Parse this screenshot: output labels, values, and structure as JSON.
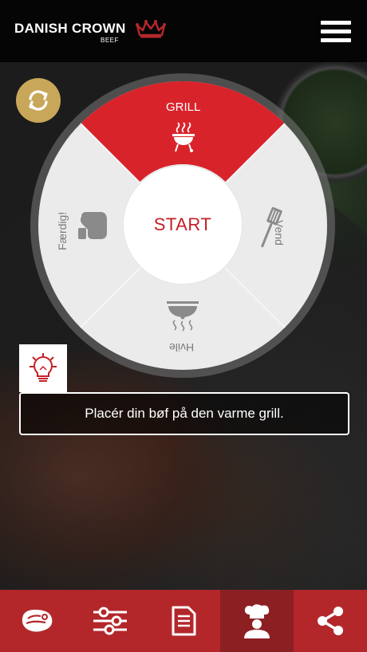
{
  "header": {
    "brand_name": "DANISH CROWN",
    "brand_sub": "BEEF",
    "crown_icon": "crown-icon",
    "menu_icon": "hamburger-menu-icon"
  },
  "wheel": {
    "segments": [
      {
        "key": "grill",
        "label": "GRILL",
        "icon": "grill-icon",
        "active": true
      },
      {
        "key": "vend",
        "label": "Vend",
        "icon": "spatula-icon",
        "active": false
      },
      {
        "key": "hvile",
        "label": "Hvile",
        "icon": "cloche-icon",
        "active": false
      },
      {
        "key": "faerdig",
        "label": "Færdig!",
        "icon": "oven-mitt-icon",
        "active": false
      }
    ],
    "start_label": "START",
    "sync_icon": "refresh-icon"
  },
  "tip": {
    "icon": "lightbulb-icon",
    "text": "Placér din bøf på den varme grill."
  },
  "nav": {
    "items": [
      {
        "icon": "steak-icon",
        "active": false
      },
      {
        "icon": "sliders-icon",
        "active": false
      },
      {
        "icon": "document-icon",
        "active": false
      },
      {
        "icon": "chef-icon",
        "active": true
      },
      {
        "icon": "share-icon",
        "active": false
      }
    ]
  },
  "colors": {
    "accent_red": "#c41e24",
    "nav_red": "#b3272b",
    "nav_active": "#8c1f22",
    "gold": "#c9a75a"
  }
}
